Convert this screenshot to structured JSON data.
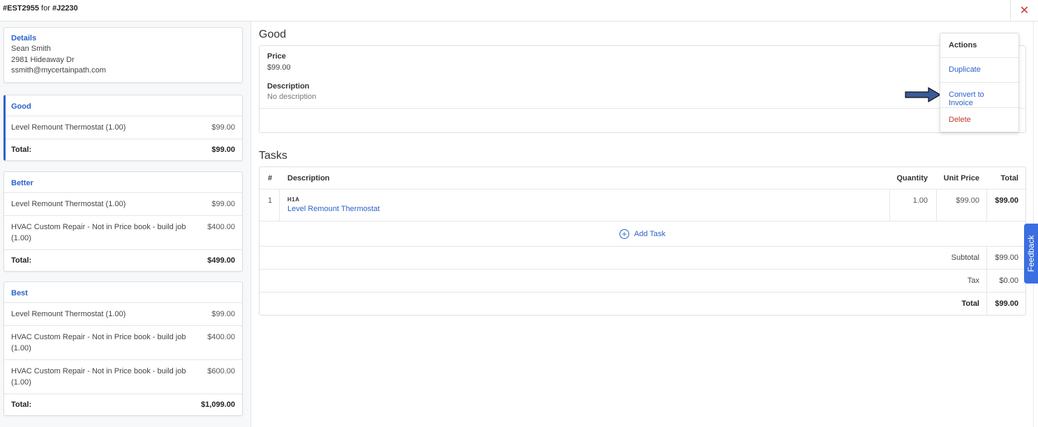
{
  "header": {
    "estimate_id": "#EST2955",
    "for_label": "for",
    "job_id": "#J2230",
    "close_icon": "close-icon"
  },
  "details": {
    "heading": "Details",
    "name": "Sean Smith",
    "address": "2981 Hideaway Dr",
    "email": "ssmith@mycertainpath.com"
  },
  "options": [
    {
      "name": "Good",
      "items": [
        {
          "desc": "Level Remount Thermostat (1.00)",
          "amount": "$99.00"
        }
      ],
      "total_label": "Total:",
      "total": "$99.00"
    },
    {
      "name": "Better",
      "items": [
        {
          "desc": "Level Remount Thermostat (1.00)",
          "amount": "$99.00"
        },
        {
          "desc": "HVAC Custom Repair - Not in Price book - build job (1.00)",
          "amount": "$400.00"
        }
      ],
      "total_label": "Total:",
      "total": "$499.00"
    },
    {
      "name": "Best",
      "items": [
        {
          "desc": "Level Remount Thermostat (1.00)",
          "amount": "$99.00"
        },
        {
          "desc": "HVAC Custom Repair - Not in Price book - build job (1.00)",
          "amount": "$400.00"
        },
        {
          "desc": "HVAC Custom Repair - Not in Price book - build job (1.00)",
          "amount": "$600.00"
        }
      ],
      "total_label": "Total:",
      "total": "$1,099.00"
    }
  ],
  "main": {
    "title": "Good",
    "price_label": "Price",
    "price_value": "$99.00",
    "description_label": "Description",
    "description_value": "No description",
    "tasks_title": "Tasks",
    "columns": {
      "num": "#",
      "description": "Description",
      "quantity": "Quantity",
      "unit_price": "Unit Price",
      "total": "Total"
    },
    "task_rows": [
      {
        "num": "1",
        "code": "H1A",
        "name": "Level Remount Thermostat",
        "quantity": "1.00",
        "unit_price": "$99.00",
        "total": "$99.00"
      }
    ],
    "add_task_label": "Add Task",
    "subtotal_label": "Subtotal",
    "subtotal_value": "$99.00",
    "tax_label": "Tax",
    "tax_value": "$0.00",
    "total_label": "Total",
    "total_value": "$99.00"
  },
  "actions": {
    "heading": "Actions",
    "duplicate": "Duplicate",
    "convert": "Convert to Invoice",
    "delete": "Delete"
  },
  "feedback_label": "Feedback",
  "colors": {
    "accent": "#2a62c9",
    "danger": "#c0392b",
    "feedback_bg": "#3b6fe0",
    "arrow_fill": "#3a5a9a"
  }
}
